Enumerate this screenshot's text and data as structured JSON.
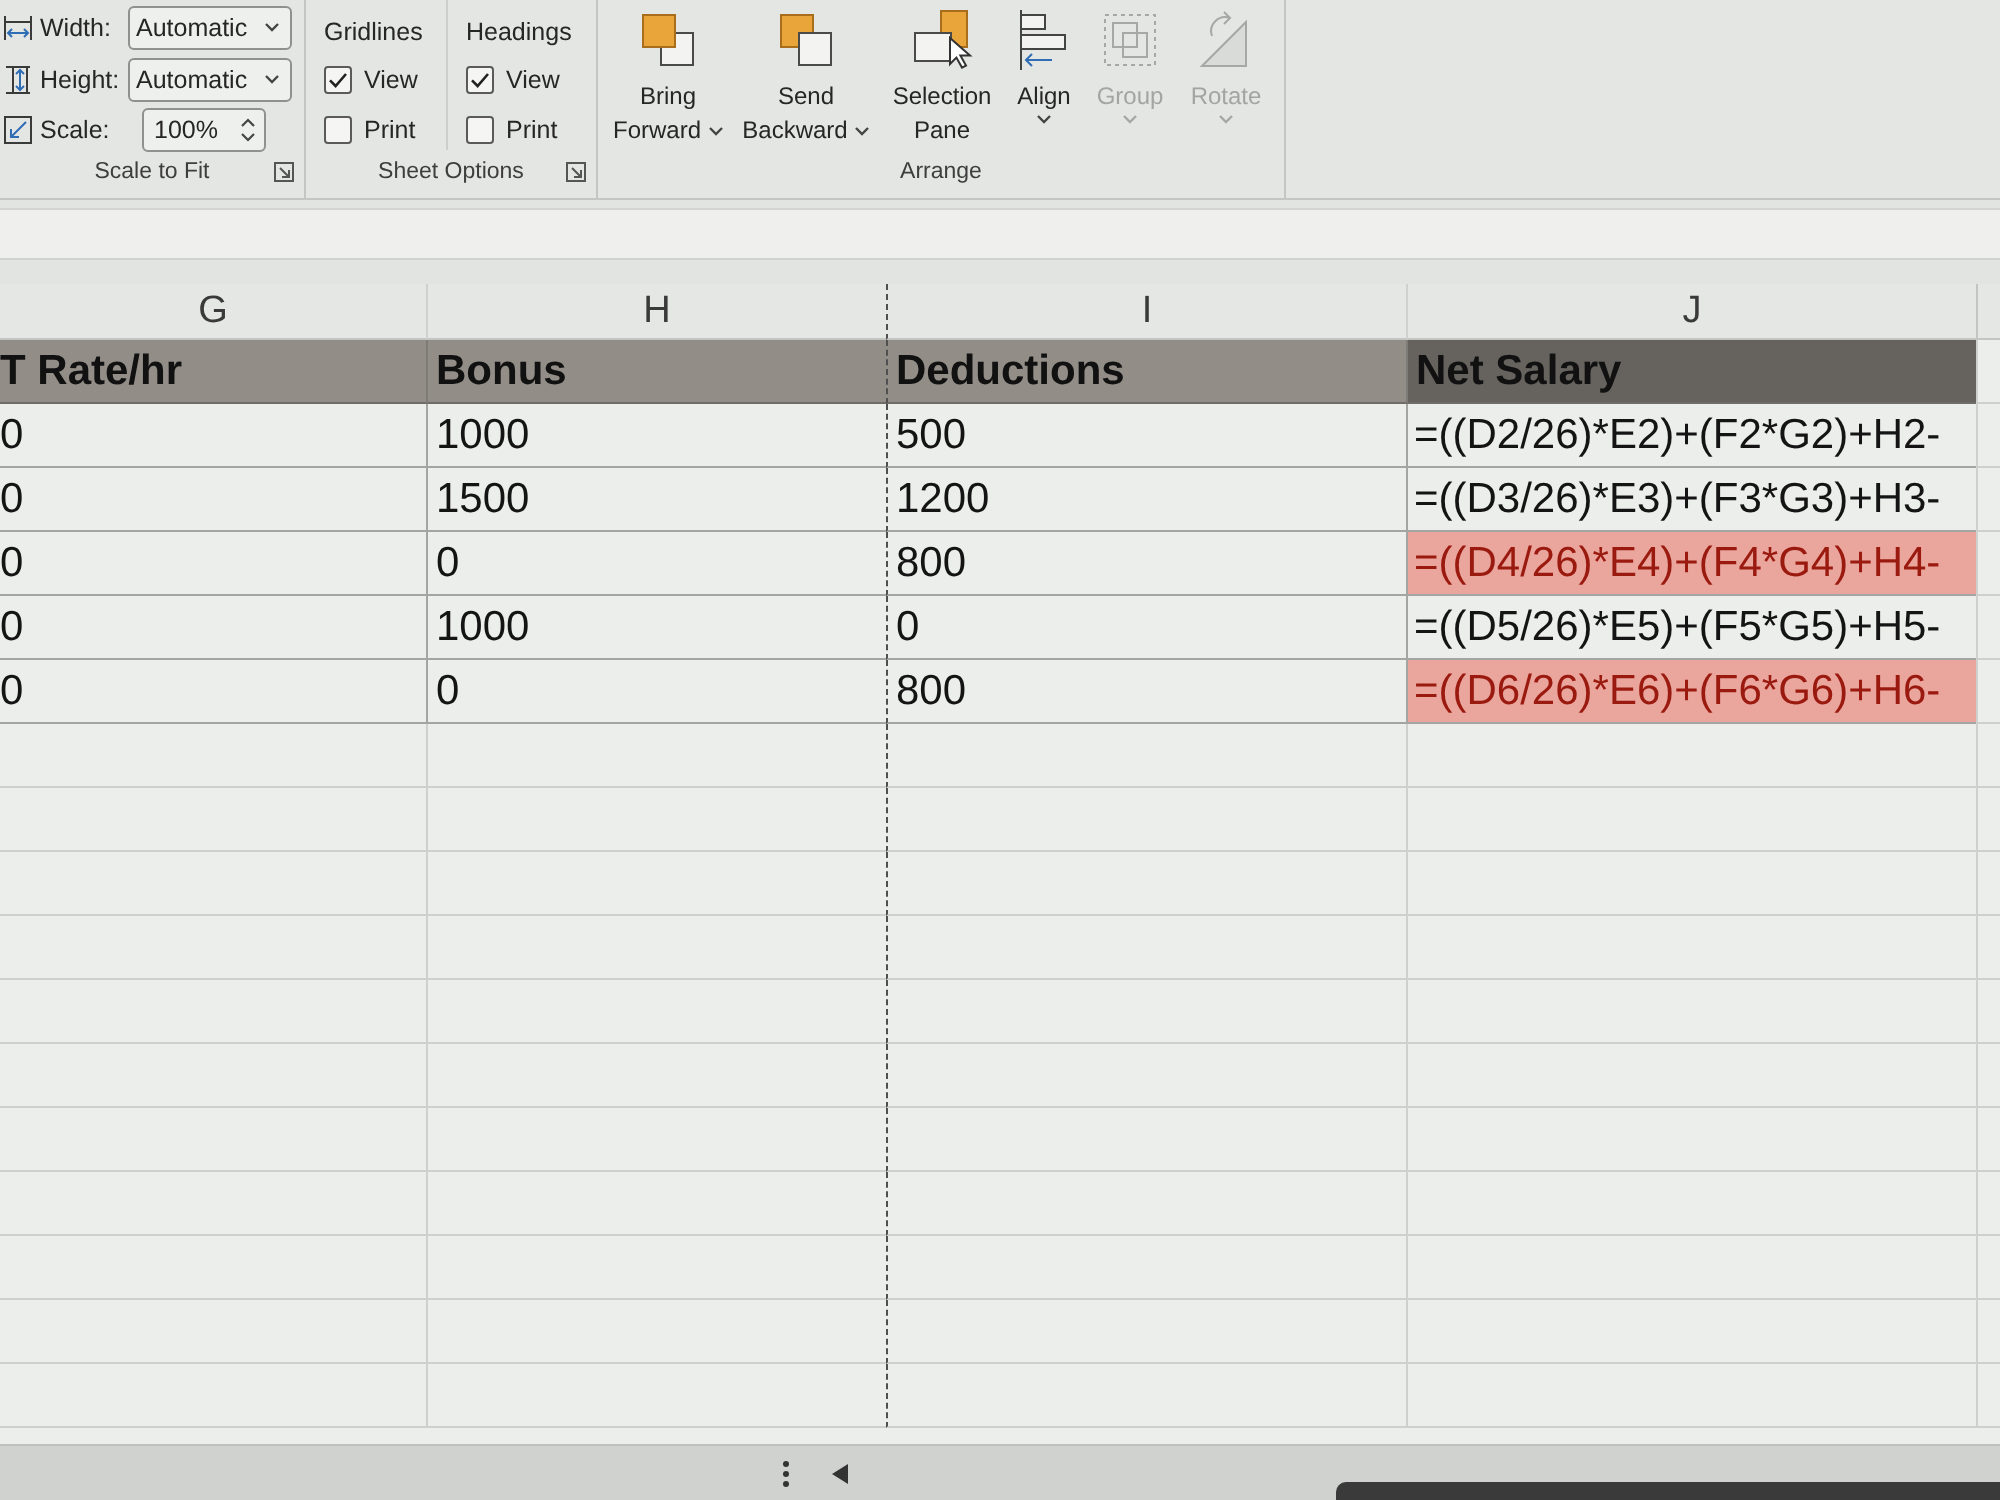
{
  "ribbon": {
    "groups": [
      {
        "kind": "scale_to_fit",
        "label": "Scale to Fit",
        "launcher": true,
        "fields": [
          {
            "label": "Width:",
            "value": "Automatic",
            "kind": "dropdown"
          },
          {
            "label": "Height:",
            "value": "Automatic",
            "kind": "dropdown"
          },
          {
            "label": "Scale:",
            "value": "100%",
            "kind": "spinner"
          }
        ]
      },
      {
        "kind": "sheet_options",
        "label": "Sheet Options",
        "launcher": true,
        "columns": [
          {
            "heading": "Gridlines",
            "options": [
              {
                "label": "View",
                "checked": true
              },
              {
                "label": "Print",
                "checked": false
              }
            ]
          },
          {
            "heading": "Headings",
            "options": [
              {
                "label": "View",
                "checked": true
              },
              {
                "label": "Print",
                "checked": false
              }
            ]
          }
        ]
      },
      {
        "kind": "arrange",
        "label": "Arrange",
        "buttons": [
          {
            "label": "Bring Forward",
            "kind": "split",
            "disabled": false
          },
          {
            "label": "Send Backward",
            "kind": "split",
            "disabled": false
          },
          {
            "label": "Selection Pane",
            "kind": "plain",
            "disabled": false
          },
          {
            "label": "Align",
            "kind": "dropdown",
            "disabled": false
          },
          {
            "label": "Group",
            "kind": "dropdown",
            "disabled": true
          },
          {
            "label": "Rotate",
            "kind": "dropdown",
            "disabled": true
          }
        ]
      }
    ]
  },
  "sheet": {
    "columns": [
      {
        "letter": "G",
        "page_break": false
      },
      {
        "letter": "H",
        "page_break": false
      },
      {
        "letter": "I",
        "page_break": true
      },
      {
        "letter": "J",
        "page_break": false
      }
    ],
    "header_cells": [
      {
        "text": "T Rate/hr",
        "color": "#928d86"
      },
      {
        "text": "Bonus",
        "color": "#928d86"
      },
      {
        "text": "Deductions",
        "color": "#928d86"
      },
      {
        "text": "Net Salary",
        "color": "#66635e"
      }
    ],
    "rows": [
      {
        "cells": [
          "0",
          "1000",
          "500",
          "=((D2/26)*E2)+(F2*G2)+H2-"
        ],
        "highlighted": false
      },
      {
        "cells": [
          "0",
          "1500",
          "1200",
          "=((D3/26)*E3)+(F3*G3)+H3-"
        ],
        "highlighted": false
      },
      {
        "cells": [
          "0",
          "0",
          "800",
          "=((D4/26)*E4)+(F4*G4)+H4-"
        ],
        "highlighted": true
      },
      {
        "cells": [
          "0",
          "1000",
          "0",
          "=((D5/26)*E5)+(F5*G5)+H5-"
        ],
        "highlighted": false
      },
      {
        "cells": [
          "0",
          "0",
          "800",
          "=((D6/26)*E6)+(F6*G6)+H6-"
        ],
        "highlighted": true
      }
    ]
  }
}
